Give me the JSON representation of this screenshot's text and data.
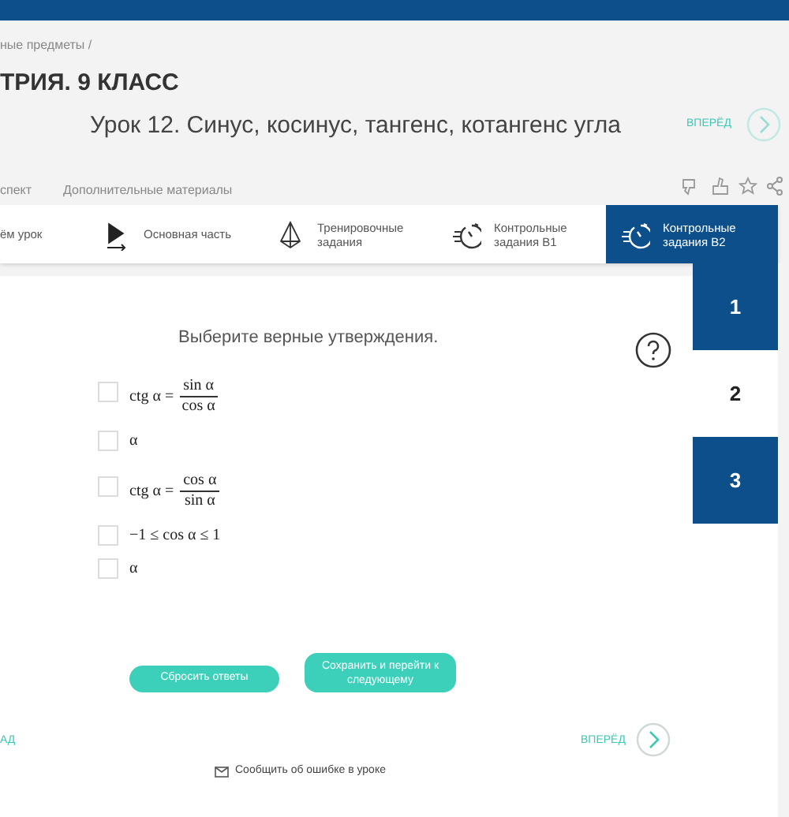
{
  "breadcrumb": "ные предметы /",
  "course_title": "ТРИЯ. 9 КЛАСС",
  "lesson_title": "Урок 12. Синус, косинус, тангенс, котангенс угла",
  "top_forward": "ВПЕРЁД",
  "lesson_tabs": [
    "спект",
    "Дополнительные материалы"
  ],
  "sections": [
    {
      "label": "ём урок",
      "kind": "intro",
      "selected": false
    },
    {
      "label": "Основная часть",
      "kind": "main",
      "selected": false
    },
    {
      "label": "Тренировочные задания",
      "kind": "training",
      "selected": false
    },
    {
      "label": "Контрольные задания В1",
      "kind": "test",
      "selected": false
    },
    {
      "label": "Контрольные задания В2",
      "kind": "test",
      "selected": true
    }
  ],
  "question": "Выберите верные утверждения.",
  "options": [
    {
      "kind": "fraction",
      "lhs": "ctg α =",
      "numerator": "sin α",
      "denominator": "cos α",
      "checked": false
    },
    {
      "kind": "text",
      "text": "α",
      "checked": false
    },
    {
      "kind": "fraction",
      "lhs": "ctg α =",
      "numerator": "cos α",
      "denominator": "sin α",
      "checked": false
    },
    {
      "kind": "text",
      "text": "−1 ≤ cos α ≤ 1",
      "checked": false
    },
    {
      "kind": "text",
      "text": "α",
      "checked": false
    }
  ],
  "task_numbers": [
    {
      "label": "1",
      "selected": false
    },
    {
      "label": "2",
      "selected": true
    },
    {
      "label": "3",
      "selected": false
    }
  ],
  "buttons": [
    "Сбросить ответы",
    "Сохранить и перейти к следующему"
  ],
  "back": "АД",
  "forward": "ВПЕРЁД",
  "report": "Сообщить об ошибке в уроке"
}
